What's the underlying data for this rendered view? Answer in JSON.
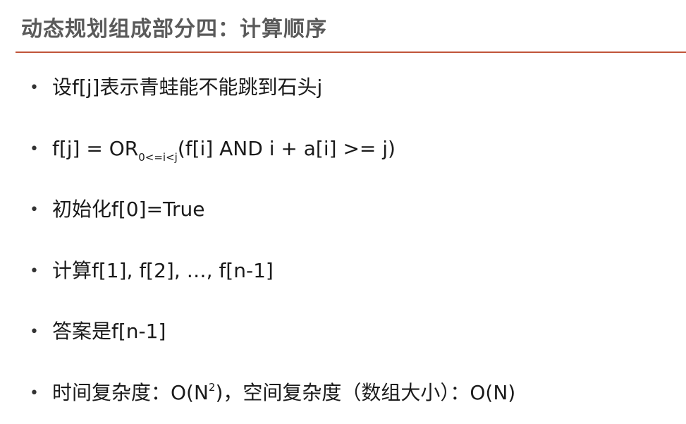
{
  "slide": {
    "title": "动态规划组成部分四：计算顺序",
    "accent_color": "#c0553a",
    "bullet_marker": "•",
    "bullets": [
      {
        "text": "设f[j]表示青蛙能不能跳到石头j"
      },
      {
        "pre": "f[j] = OR",
        "sub": "0<=i<j",
        "post": "(f[i] AND i + a[i] >= j)"
      },
      {
        "text": "初始化f[0]=True"
      },
      {
        "text": "计算f[1], f[2], …, f[n-1]"
      },
      {
        "text": "答案是f[n-1]"
      },
      {
        "pre": "时间复杂度：O(N",
        "sup": "2",
        "post": ")，空间复杂度（数组大小）：O(N)"
      }
    ]
  }
}
